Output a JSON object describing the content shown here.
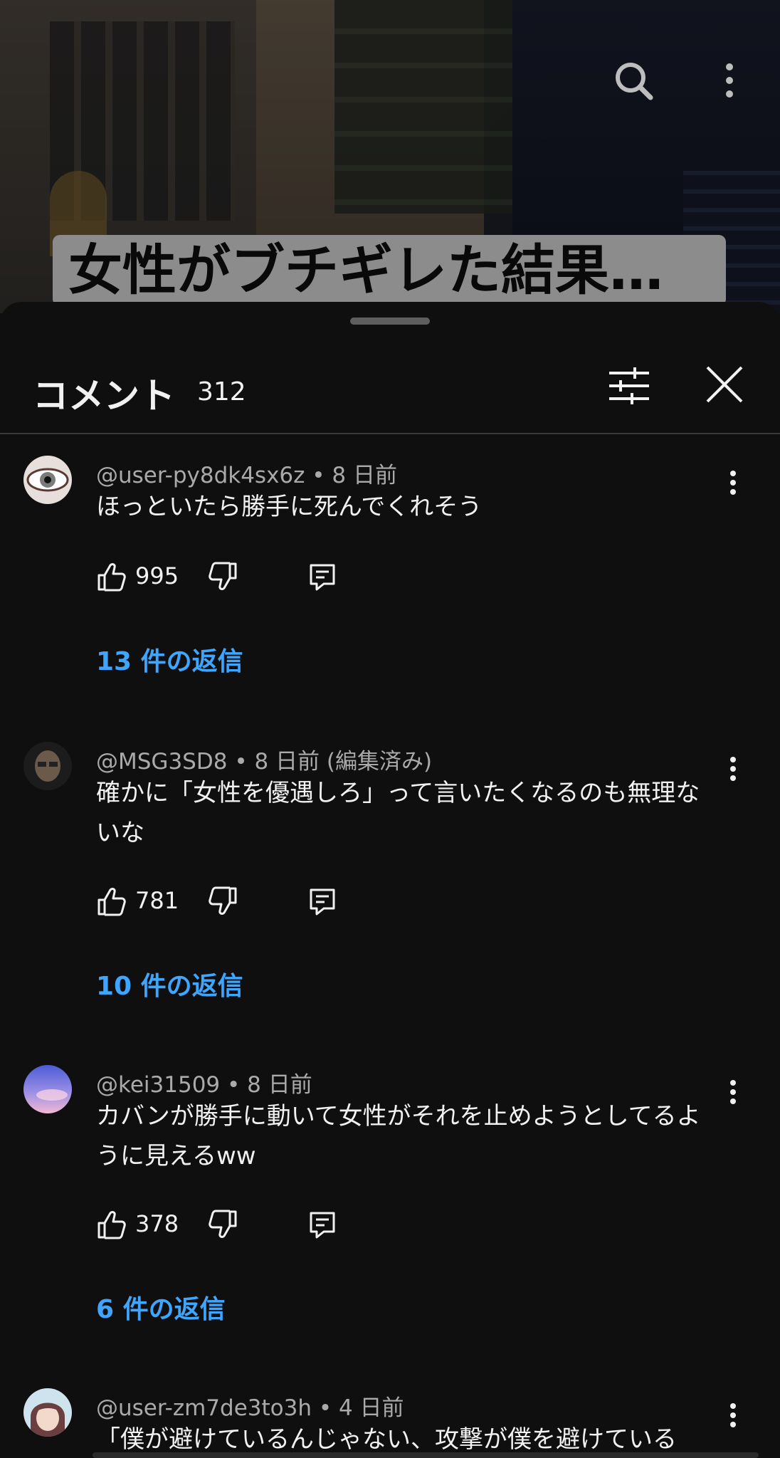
{
  "video": {
    "caption": "女性がブチギレた結果…",
    "top_icons": [
      "search-icon",
      "more-vert-icon"
    ]
  },
  "sheet": {
    "title": "コメント",
    "count": "312",
    "icons": [
      "tune-icon",
      "close-icon"
    ]
  },
  "comments": [
    {
      "author": "@user-py8dk4sx6z",
      "time": "8 日前",
      "edited": "",
      "text": "ほっといたら勝手に死んでくれそう",
      "likes": "995",
      "replies": "13 件の返信"
    },
    {
      "author": "@MSG3SD8",
      "time": "8 日前",
      "edited": "(編集済み)",
      "text": "確かに「女性を優遇しろ」って言いたくなるのも無理ないな",
      "likes": "781",
      "replies": "10 件の返信"
    },
    {
      "author": "@kei31509",
      "time": "8 日前",
      "edited": "",
      "text": "カバンが勝手に動いて女性がそれを止めようとしてるように見えるww",
      "likes": "378",
      "replies": "6 件の返信"
    },
    {
      "author": "@user-zm7de3to3h",
      "time": "4 日前",
      "edited": "",
      "text": "「僕が避けているんじゃない、攻撃が僕を避けている"
    }
  ],
  "colors": {
    "background": "#0f0f0f",
    "text": "#f1f1f1",
    "meta": "#aaaaaa",
    "reply_link": "#3ea6ff"
  }
}
